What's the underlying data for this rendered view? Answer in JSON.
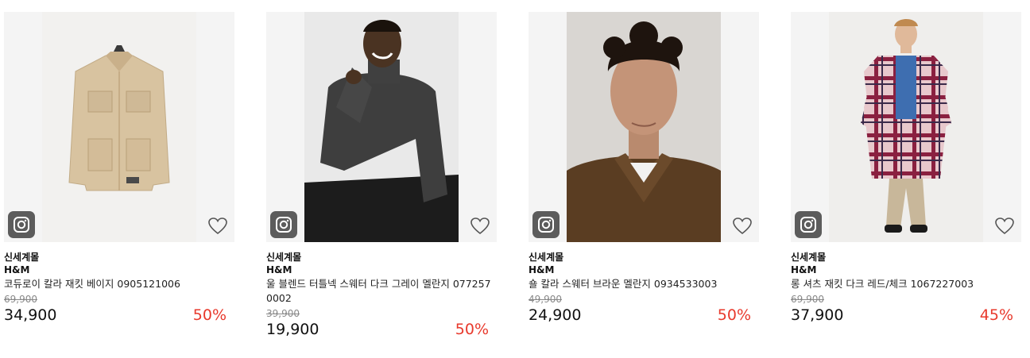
{
  "products": [
    {
      "store": "신세계몰",
      "brand": "H&M",
      "name": "코듀로이 칼라 재킷 베이지 0905121006",
      "original_price": "69,900",
      "price": "34,900",
      "discount": "50%",
      "image": "beige-corduroy-collar-jacket",
      "bg_color": "#d8c3a0"
    },
    {
      "store": "신세계몰",
      "brand": "H&M",
      "name": "울 블렌드 터틀넥 스웨터 다크 그레이 멜란지 0772570002",
      "original_price": "39,900",
      "price": "19,900",
      "discount": "50%",
      "image": "man-in-dark-gray-turtleneck",
      "bg_color": "#3d3d3d"
    },
    {
      "store": "신세계몰",
      "brand": "H&M",
      "name": "숄 칼라 스웨터 브라운 멜란지 0934533003",
      "original_price": "49,900",
      "price": "24,900",
      "discount": "50%",
      "image": "man-in-brown-shawl-collar-sweater",
      "bg_color": "#5a3d22"
    },
    {
      "store": "신세계몰",
      "brand": "H&M",
      "name": "롱 셔츠 재킷 다크 레드/체크 1067227003",
      "original_price": "69,900",
      "price": "37,900",
      "discount": "45%",
      "image": "woman-in-long-check-shirt-jacket",
      "bg_color": "#c88a9a"
    }
  ],
  "icons": {
    "snapshot": "instagram-camera-icon",
    "wishlist": "heart-outline-icon"
  },
  "colors": {
    "discount": "#e8392c",
    "original_price": "#888888",
    "icon_badge": "#5c5c5c"
  }
}
